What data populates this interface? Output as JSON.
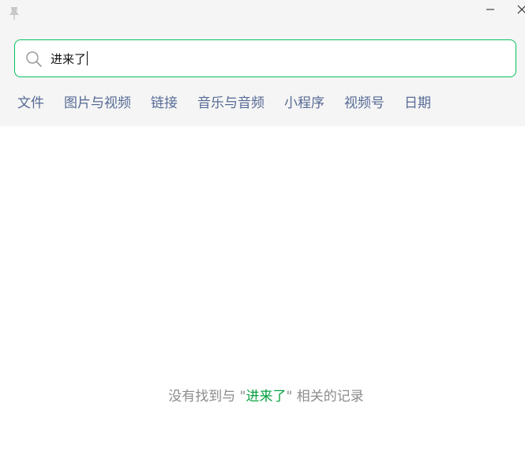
{
  "window": {
    "icons": {
      "pin": "pin-icon",
      "minimize": "minimize-icon",
      "close": "close-icon"
    }
  },
  "search": {
    "value": "进来了",
    "icon": "search-icon",
    "focus_color": "#07c160"
  },
  "filters": {
    "items": [
      {
        "label": "文件"
      },
      {
        "label": "图片与视频"
      },
      {
        "label": "链接"
      },
      {
        "label": "音乐与音频"
      },
      {
        "label": "小程序"
      },
      {
        "label": "视频号"
      },
      {
        "label": "日期"
      }
    ],
    "color": "#576b95"
  },
  "empty_state": {
    "prefix": "没有找到与 \"",
    "keyword": "进来了",
    "suffix": "\" 相关的记录",
    "keyword_color": "#07a140"
  }
}
